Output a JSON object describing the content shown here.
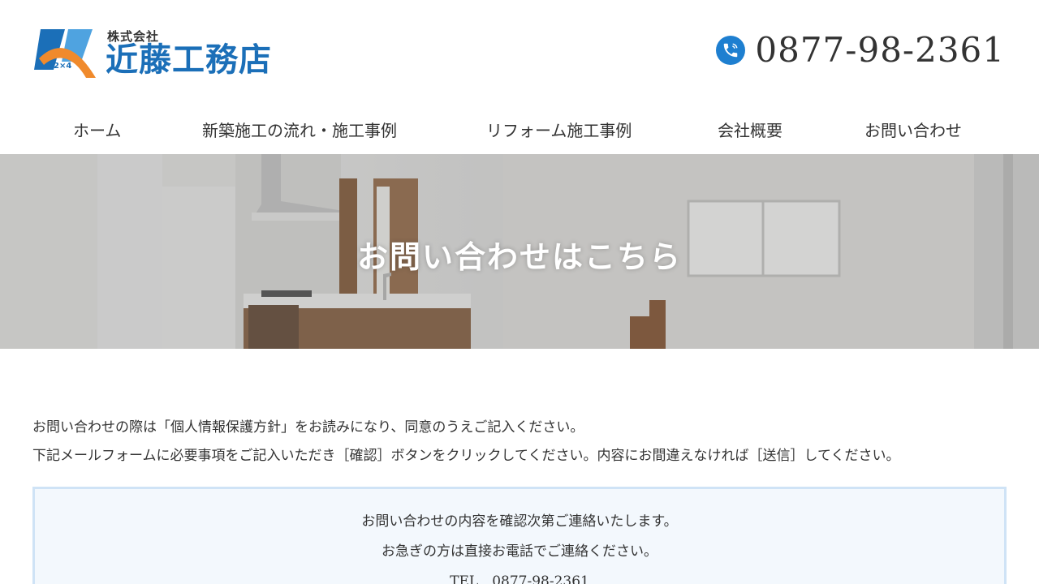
{
  "header": {
    "logo_small": "株式会社",
    "logo_name": "近藤工務店",
    "logo_mark_text": "2×4",
    "phone_icon": "phone-icon",
    "phone_number": "0877-98-2361"
  },
  "nav": {
    "items": [
      {
        "label": "ホーム"
      },
      {
        "label": "新築施工の流れ・施工事例"
      },
      {
        "label": "リフォーム施工事例"
      },
      {
        "label": "会社概要"
      },
      {
        "label": "お問い合わせ"
      }
    ]
  },
  "hero": {
    "title": "お問い合わせはこちら"
  },
  "intro": {
    "line1": "お問い合わせの際は「個人情報保護方針」をお読みになり、同意のうえご記入ください。",
    "line2": "下記メールフォームに必要事項をご記入いただき［確認］ボタンをクリックしてください。内容にお間違えなければ［送信］してください。"
  },
  "notice": {
    "line1": "お問い合わせの内容を確認次第ご連絡いたします。",
    "line2": "お急ぎの方は直接お電話でご連絡ください。",
    "line3": "TEL　0877-98-2361"
  },
  "colors": {
    "brand_blue": "#1b6fb8",
    "logo_orange": "#f08a2c",
    "notice_border": "#cfe3f6",
    "notice_bg": "#f3f8fd"
  }
}
